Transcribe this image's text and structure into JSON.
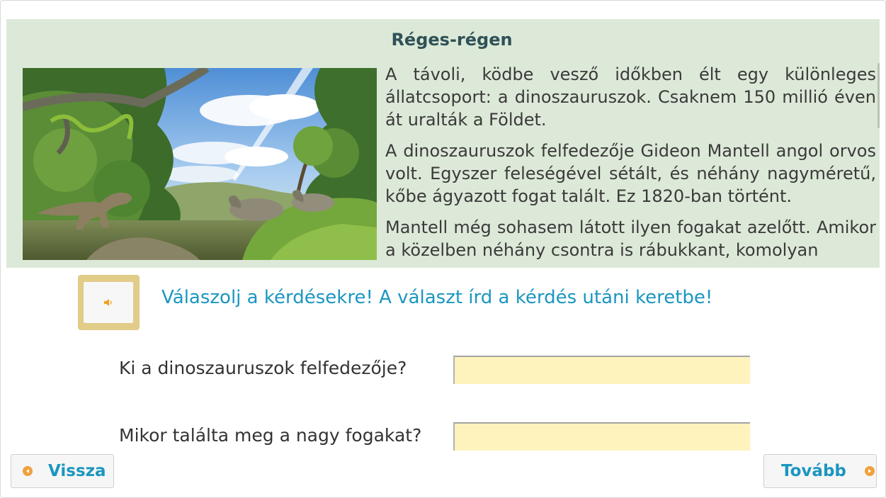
{
  "reading": {
    "title": "Réges-régen",
    "paragraphs": [
      "A távoli, ködbe vesző időkben élt egy különleges állatcsoport: a dinoszauruszok. Csaknem 150 millió éven át uralták a Földet.",
      "A dinoszauruszok felfedezője Gideon Mantell angol orvos volt. Egyszer feleségével sétált, és néhány nagyméretű, kőbe ágyazott fogat talált. Ez 1820-ban történt.",
      "Mantell még sohasem látott ilyen fogakat azelőtt. Amikor a közelben néhány csontra is rábukkant, komolyan"
    ]
  },
  "instruction": {
    "text": "Válaszolj a kérdésekre! A választ írd a kérdés utáni keretbe!"
  },
  "questions": [
    {
      "label": "Ki a dinoszauruszok felfedezője?",
      "value": ""
    },
    {
      "label": "Mikor találta meg a nagy fogakat?",
      "value": ""
    }
  ],
  "nav": {
    "back_label": "Vissza",
    "next_label": "Tovább"
  },
  "colors": {
    "panel_bg": "#dde9d8",
    "accent_blue": "#1b96c0",
    "audio_frame": "#e1cc88",
    "answer_bg": "#fff3bd",
    "arrow_orange": "#f0a03c"
  },
  "icons": {
    "audio": "speaker-icon",
    "back": "arrow-left-icon",
    "next": "arrow-right-icon"
  }
}
